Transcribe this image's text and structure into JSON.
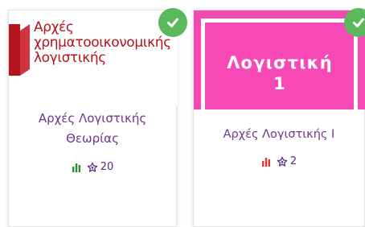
{
  "cards": [
    {
      "logo_lines": [
        "Αρχές",
        "χρηματοοικονομικής",
        "λογιστικής"
      ],
      "title_lines": [
        "Αρχές Λογιστικής",
        "Θεωρίας"
      ],
      "rating": "20",
      "level_color": "#2e8b2e",
      "level_icon": "bar-chart-icon",
      "completed": true
    },
    {
      "hero_lines": [
        "Λογιστική",
        "1"
      ],
      "title_lines": [
        "Αρχές Λογιστικής Ι"
      ],
      "rating": "2",
      "level_color": "#e53935",
      "level_icon": "bar-chart-icon",
      "completed": true
    }
  ],
  "colors": {
    "brand_red": "#b3131f",
    "hero_pink": "#f749b5",
    "title_purple": "#72338a",
    "check_green": "#5cb85c"
  }
}
